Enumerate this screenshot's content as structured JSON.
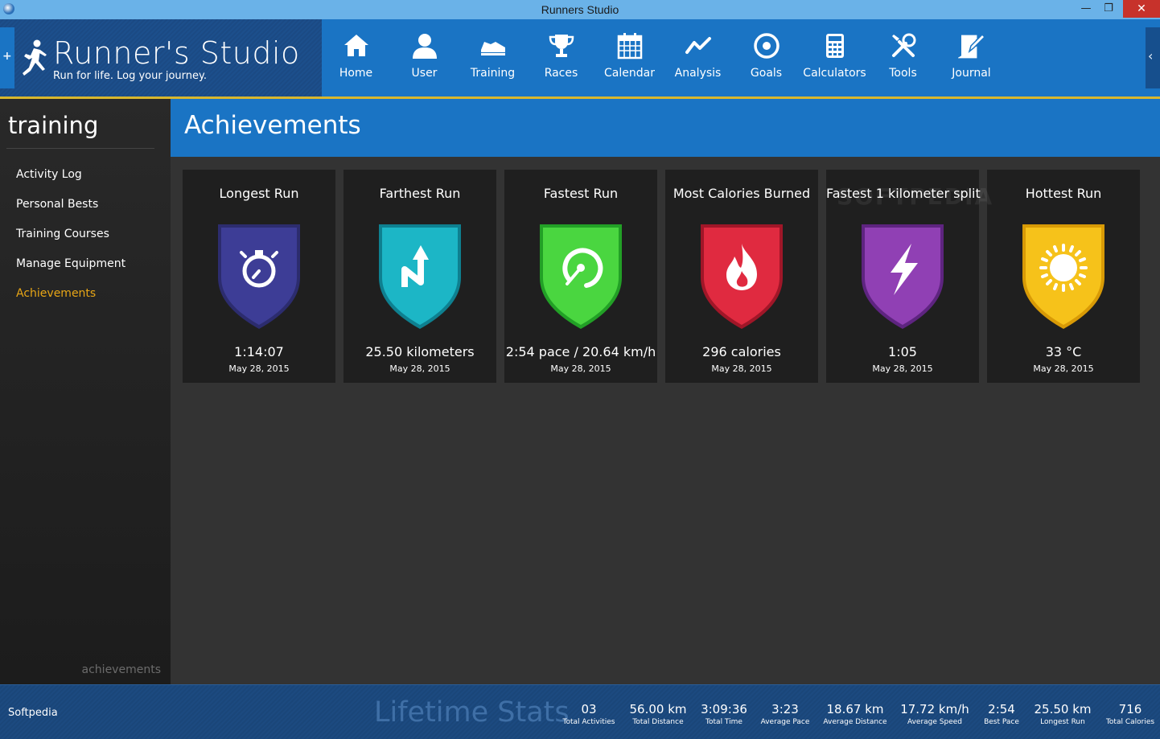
{
  "window": {
    "title": "Runners Studio",
    "minimize": "—",
    "maximize": "❐",
    "close": "✕"
  },
  "brand": {
    "name": "Runner's Studio",
    "tagline": "Run for life. Log your journey.",
    "expand_glyph": "+",
    "collapse_glyph": "‹"
  },
  "nav": [
    {
      "label": "Home",
      "icon": "home-icon"
    },
    {
      "label": "User",
      "icon": "user-icon"
    },
    {
      "label": "Training",
      "icon": "shoe-icon"
    },
    {
      "label": "Races",
      "icon": "trophy-icon"
    },
    {
      "label": "Calendar",
      "icon": "calendar-icon"
    },
    {
      "label": "Analysis",
      "icon": "trend-icon"
    },
    {
      "label": "Goals",
      "icon": "target-icon"
    },
    {
      "label": "Calculators",
      "icon": "calculator-icon"
    },
    {
      "label": "Tools",
      "icon": "tools-icon"
    },
    {
      "label": "Journal",
      "icon": "journal-icon"
    }
  ],
  "sidebar": {
    "title": "training",
    "items": [
      {
        "label": "Activity Log",
        "active": false
      },
      {
        "label": "Personal Bests",
        "active": false
      },
      {
        "label": "Training Courses",
        "active": false
      },
      {
        "label": "Manage Equipment",
        "active": false
      },
      {
        "label": "Achievements",
        "active": true
      }
    ],
    "footer_label": "achievements",
    "active_color": "#e8a616"
  },
  "main": {
    "title": "Achievements",
    "cards": [
      {
        "title": "Longest Run",
        "value": "1:14:07",
        "date": "May 28, 2015",
        "color": "#3a3a8e",
        "icon": "stopwatch-icon"
      },
      {
        "title": "Farthest Run",
        "value": "25.50 kilometers",
        "date": "May 28, 2015",
        "color": "#18a8b8",
        "icon": "route-arrow-icon"
      },
      {
        "title": "Fastest Run",
        "value": "2:54 pace / 20.64 km/h",
        "date": "May 28, 2015",
        "color": "#3ccc3a",
        "icon": "speedometer-icon"
      },
      {
        "title": "Most Calories Burned",
        "value": "296 calories",
        "date": "May 28, 2015",
        "color": "#d8283c",
        "icon": "flame-icon"
      },
      {
        "title": "Fastest 1 kilometer split",
        "value": "1:05",
        "date": "May 28, 2015",
        "color": "#8a3aaa",
        "icon": "lightning-icon"
      },
      {
        "title": "Hottest Run",
        "value": "33 °C",
        "date": "May 28, 2015",
        "color": "#f0b810",
        "icon": "sun-icon"
      }
    ],
    "watermark": "SOFTPEDIA"
  },
  "footer": {
    "brand": "Softpedia",
    "title": "Lifetime Stats",
    "stats": [
      {
        "value": "03",
        "label": "Total Activities"
      },
      {
        "value": "56.00 km",
        "label": "Total Distance"
      },
      {
        "value": "3:09:36",
        "label": "Total Time"
      },
      {
        "value": "3:23",
        "label": "Average Pace"
      },
      {
        "value": "18.67 km",
        "label": "Average Distance"
      },
      {
        "value": "17.72 km/h",
        "label": "Average Speed"
      },
      {
        "value": "2:54",
        "label": "Best Pace"
      },
      {
        "value": "25.50 km",
        "label": "Longest Run"
      },
      {
        "value": "716",
        "label": "Total Calories"
      }
    ]
  },
  "colors": {
    "header_blue": "#1a74c4",
    "gold_rule": "#d8b72e",
    "close_red": "#c7322b"
  }
}
